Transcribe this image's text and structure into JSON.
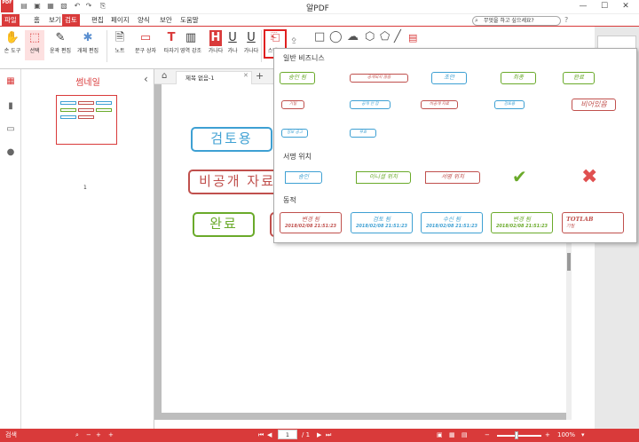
{
  "app": {
    "title": "알PDF",
    "logo": "PDF",
    "search_placeholder": "무엇을 하고 싶으세요?"
  },
  "menu": [
    "파일",
    "홈",
    "보기",
    "검토",
    "편집",
    "페이지",
    "양식",
    "보안",
    "도움말"
  ],
  "menu_active": "검토",
  "ribbon": [
    {
      "label": "손 도구",
      "icon": "hand-icon"
    },
    {
      "label": "선택",
      "icon": "select-icon"
    },
    {
      "label": "윤곽 편집",
      "icon": "outline-edit-icon"
    },
    {
      "label": "개체 편집",
      "icon": "object-edit-icon"
    },
    {
      "label": "노트",
      "icon": "note-icon"
    },
    {
      "label": "문구 상자",
      "icon": "textbox-icon"
    },
    {
      "label": "타자기",
      "icon": "typewriter-icon"
    },
    {
      "label": "영역 강조",
      "icon": "area-highlight-icon"
    },
    {
      "label": "가나다",
      "icon": "highlight-icon"
    },
    {
      "label": "가나",
      "icon": "underline-icon"
    },
    {
      "label": "가나다",
      "icon": "underline2-icon"
    },
    {
      "label": "스탬프",
      "icon": "stamp-icon"
    }
  ],
  "thumbnail": {
    "title": "썸네일",
    "page_number": "1"
  },
  "tab": {
    "label": "제목 없음-1"
  },
  "doc_stamps": [
    {
      "text": "검토용",
      "color": "#3ea0d3"
    },
    {
      "text": "비공개 자료",
      "color": "#c0504d"
    },
    {
      "text": "완료",
      "color": "#6aaa2a"
    }
  ],
  "stamp_menu": {
    "section1": "일반 비즈니스",
    "section2": "서명 위치",
    "section3": "동적",
    "general": [
      {
        "text": "승인 됨",
        "color": "#6aaa2a"
      },
      {
        "text": "공개되지 않음",
        "color": "#c0504d"
      },
      {
        "text": "초안",
        "color": "#3ea0d3"
      },
      {
        "text": "최종",
        "color": "#6aaa2a"
      },
      {
        "text": "완료",
        "color": "#6aaa2a"
      },
      {
        "text": "기밀",
        "color": "#c0504d"
      },
      {
        "text": "공개 안 함",
        "color": "#3ea0d3"
      },
      {
        "text": "비공개 자료",
        "color": "#c0504d"
      },
      {
        "text": "검토용",
        "color": "#3ea0d3"
      },
      {
        "text": "비어있음",
        "color": "#c0504d"
      },
      {
        "text": "정보 공고",
        "color": "#3ea0d3"
      },
      {
        "text": "무효",
        "color": "#3ea0d3"
      }
    ],
    "sign": [
      {
        "text": "승인",
        "color": "#3ea0d3"
      },
      {
        "text": "이니셜 위치",
        "color": "#6aaa2a"
      },
      {
        "text": "서명 위치",
        "color": "#c0504d"
      }
    ],
    "dynamic": [
      {
        "text": "변경 됨",
        "date": "2018/02/08 21:51:23",
        "color": "#c0504d"
      },
      {
        "text": "검토 됨",
        "date": "2018/02/08 21:51:23",
        "color": "#3ea0d3"
      },
      {
        "text": "수신 됨",
        "date": "2018/02/08 21:51:23",
        "color": "#3ea0d3"
      },
      {
        "text": "변경 됨",
        "date": "2018/02/08 21:51:23",
        "color": "#6aaa2a"
      },
      {
        "text": "TOTLAB",
        "date": "기밀",
        "color": "#c0504d"
      }
    ]
  },
  "status": {
    "left": "검색",
    "page_current": "1",
    "page_total": "/ 1",
    "zoom": "100%"
  }
}
